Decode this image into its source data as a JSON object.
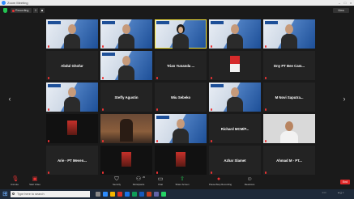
{
  "window": {
    "title": "Zoom Meeting"
  },
  "topbar": {
    "recording_label": "Recording",
    "view_label": "View"
  },
  "tiles": [
    {
      "kind": "vid",
      "name": "",
      "tag": "",
      "muted": true
    },
    {
      "kind": "vid",
      "name": "",
      "tag": "",
      "muted": true
    },
    {
      "kind": "hijab",
      "name": "",
      "tag": "",
      "muted": false,
      "active": true
    },
    {
      "kind": "vid",
      "name": "",
      "tag": "",
      "muted": true
    },
    {
      "kind": "vid",
      "name": "",
      "tag": "",
      "muted": true
    },
    {
      "kind": "name",
      "name": "Abdul Ghofur",
      "tag": "",
      "muted": true
    },
    {
      "kind": "vid",
      "name": "",
      "tag": "",
      "muted": true
    },
    {
      "kind": "name",
      "name": "Trian Yunanda ...",
      "tag": "",
      "muted": true
    },
    {
      "kind": "flag",
      "name": "",
      "tag": "",
      "muted": true
    },
    {
      "kind": "name",
      "name": "Dny PT Bee Cam...",
      "tag": "",
      "muted": true
    },
    {
      "kind": "vid",
      "name": "",
      "tag": "",
      "muted": true
    },
    {
      "kind": "name",
      "name": "Steffy Agustin",
      "tag": "",
      "muted": true
    },
    {
      "kind": "name",
      "name": "Wiu Sebeko",
      "tag": "",
      "muted": true
    },
    {
      "kind": "vid",
      "name": "",
      "tag": "",
      "muted": true
    },
    {
      "kind": "name",
      "name": "M Novi Saputra...",
      "tag": "",
      "muted": true
    },
    {
      "kind": "dark",
      "name": "",
      "tag": "",
      "muted": true
    },
    {
      "kind": "scene",
      "name": "",
      "tag": "",
      "muted": true
    },
    {
      "kind": "vid",
      "name": "",
      "tag": "",
      "muted": true
    },
    {
      "kind": "name",
      "name": "Richard MCM/P...",
      "tag": "",
      "muted": true
    },
    {
      "kind": "plain",
      "name": "",
      "tag": "",
      "muted": true
    },
    {
      "kind": "name",
      "name": "Arie - PT Meven...",
      "tag": "",
      "muted": true
    },
    {
      "kind": "dark",
      "name": "",
      "tag": "",
      "muted": true
    },
    {
      "kind": "dark",
      "name": "",
      "tag": "",
      "muted": true
    },
    {
      "kind": "name",
      "name": "Azhar Slamet",
      "tag": "",
      "muted": true
    },
    {
      "kind": "name",
      "name": "Ahmad M - PT...",
      "tag": "",
      "muted": true
    }
  ],
  "toolbar": {
    "buttons": [
      {
        "id": "unmute",
        "label": "Unmute",
        "icon": "microphone-icon"
      },
      {
        "id": "video",
        "label": "Start Video",
        "icon": "camera-icon"
      },
      {
        "id": "security",
        "label": "Security",
        "icon": "shield-icon"
      },
      {
        "id": "participants",
        "label": "Participants",
        "icon": "people-icon",
        "badge": "25"
      },
      {
        "id": "chat",
        "label": "Chat",
        "icon": "chat-icon"
      },
      {
        "id": "share",
        "label": "Share Screen",
        "icon": "share-screen-icon"
      },
      {
        "id": "record",
        "label": "Pause/Stop Recording",
        "icon": "record-icon"
      },
      {
        "id": "reactions",
        "label": "Reactions",
        "icon": "reactions-icon"
      }
    ],
    "end_label": "End"
  },
  "taskbar": {
    "search_placeholder": "Type here to search"
  }
}
